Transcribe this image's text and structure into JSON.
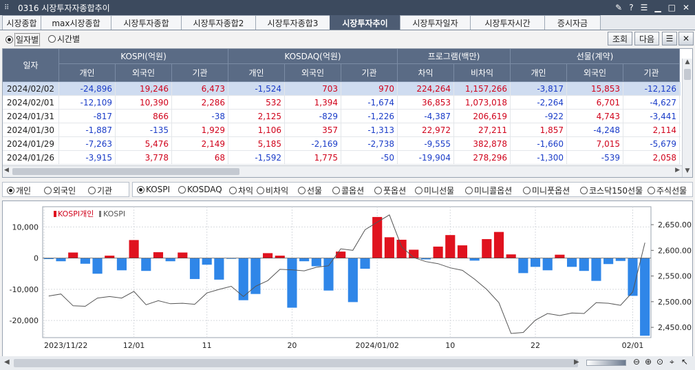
{
  "window": {
    "title": "0316 시장투자자종합추이"
  },
  "tabs": [
    "시장종합",
    "max시장종합",
    "시장투자종합",
    "시장투자종합2",
    "시장투자종합3",
    "시장투자추이",
    "시장투자일자",
    "시장투자시간",
    "증시자금"
  ],
  "active_tab": 5,
  "period_options": [
    "일자별",
    "시간별"
  ],
  "buttons": {
    "query": "조회",
    "next": "다음"
  },
  "table": {
    "date_header": "일자",
    "groups": [
      "KOSPI(억원)",
      "KOSDAQ(억원)",
      "프로그램(백만)",
      "선물(계약)"
    ],
    "subheaders": [
      "개인",
      "외국인",
      "기관",
      "개인",
      "외국인",
      "기관",
      "차익",
      "비차익",
      "개인",
      "외국인",
      "기관"
    ],
    "rows": [
      {
        "date": "2024/02/02",
        "values": [
          "-24,896",
          "19,246",
          "6,473",
          "-1,524",
          "703",
          "970",
          "224,264",
          "1,157,266",
          "-3,817",
          "15,853",
          "-12,126"
        ]
      },
      {
        "date": "2024/02/01",
        "values": [
          "-12,109",
          "10,390",
          "2,286",
          "532",
          "1,394",
          "-1,674",
          "36,853",
          "1,073,018",
          "-2,264",
          "6,701",
          "-4,627"
        ]
      },
      {
        "date": "2024/01/31",
        "values": [
          "-817",
          "866",
          "-38",
          "2,125",
          "-829",
          "-1,226",
          "-4,387",
          "206,619",
          "-922",
          "4,743",
          "-3,441"
        ]
      },
      {
        "date": "2024/01/30",
        "values": [
          "-1,887",
          "-135",
          "1,929",
          "1,106",
          "357",
          "-1,313",
          "22,972",
          "27,211",
          "1,857",
          "-4,248",
          "2,114"
        ]
      },
      {
        "date": "2024/01/29",
        "values": [
          "-7,263",
          "5,476",
          "2,149",
          "5,185",
          "-2,169",
          "-2,738",
          "-9,555",
          "382,878",
          "-1,660",
          "7,015",
          "-5,679"
        ]
      },
      {
        "date": "2024/01/26",
        "values": [
          "-3,915",
          "3,778",
          "68",
          "-1,592",
          "1,775",
          "-50",
          "-19,904",
          "278,296",
          "-1,300",
          "-539",
          "2,058"
        ]
      }
    ]
  },
  "investor_options": [
    "개인",
    "외국인",
    "기관"
  ],
  "market_options": [
    "KOSPI",
    "KOSDAQ",
    "차익",
    "비차익",
    "선물",
    "콜옵션",
    "풋옵션",
    "미니선물",
    "미니콜옵션",
    "미니풋옵션",
    "코스닥150선물",
    "주식선물"
  ],
  "chart_data": {
    "type": "bar",
    "title": "",
    "legend": [
      "KOSPI개인",
      "KOSPI"
    ],
    "legend_placement": "top-left",
    "grid": true,
    "x_ticks": [
      {
        "index": 0,
        "label": "2023/11/22"
      },
      {
        "index": 7,
        "label": "12/01"
      },
      {
        "index": 13,
        "label": "11"
      },
      {
        "index": 20,
        "label": "20"
      },
      {
        "index": 27,
        "label": "2024/01/02"
      },
      {
        "index": 33,
        "label": "10"
      },
      {
        "index": 40,
        "label": "22"
      },
      {
        "index": 48,
        "label": "02/01"
      }
    ],
    "y_left": {
      "ticks": [
        10000,
        0,
        -10000,
        -20000
      ],
      "tick_labels": [
        "10,000",
        "0",
        "-10,000",
        "-20,000"
      ],
      "range": [
        -25500,
        16500
      ]
    },
    "y_right": {
      "ticks": [
        2450,
        2500,
        2550,
        2600,
        2650
      ],
      "tick_labels": [
        "2,450.00",
        "2,500.00",
        "2,550.00",
        "2,600.00",
        "2,650.00"
      ],
      "range": [
        2430,
        2685
      ]
    },
    "bar_positive_color": "#e0121e",
    "bar_negative_color": "#2f86e8",
    "line_color": "#555555",
    "series": [
      {
        "name": "KOSPI개인",
        "values": [
          -300,
          -1000,
          1800,
          -1800,
          -5000,
          800,
          -3900,
          5800,
          -4100,
          1900,
          -1000,
          1800,
          -6700,
          -2100,
          -6900,
          -200,
          -13500,
          -11500,
          1600,
          800,
          -15900,
          -1000,
          -2600,
          -10400,
          2100,
          -14100,
          -3400,
          13200,
          6700,
          5900,
          2700,
          -400,
          3700,
          7400,
          4100,
          -800,
          6100,
          8400,
          1200,
          -4800,
          -2800,
          -3900,
          1100,
          -2800,
          -4100,
          -7300,
          -1900,
          -900,
          -12100,
          -24900
        ]
      },
      {
        "name": "KOSPI",
        "values": [
          2511,
          2515,
          2492,
          2491,
          2507,
          2510,
          2507,
          2520,
          2494,
          2502,
          2496,
          2497,
          2495,
          2517,
          2524,
          2530,
          2510,
          2530,
          2541,
          2563,
          2562,
          2560,
          2567,
          2570,
          2603,
          2600,
          2640,
          2655,
          2669,
          2607,
          2586,
          2578,
          2574,
          2566,
          2561,
          2544,
          2524,
          2498,
          2438,
          2440,
          2464,
          2477,
          2473,
          2478,
          2477,
          2498,
          2497,
          2493,
          2519,
          2615
        ]
      }
    ]
  }
}
